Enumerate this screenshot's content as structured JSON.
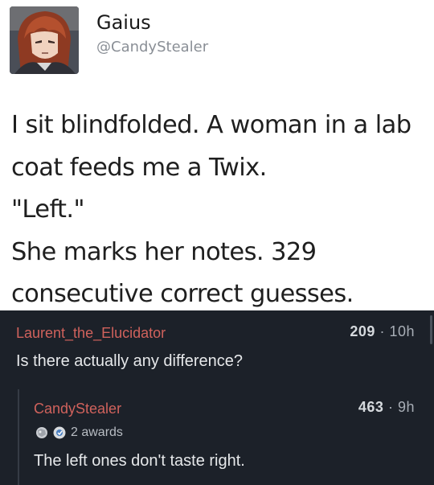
{
  "tweet": {
    "author_name": "Gaius",
    "author_handle": "@CandyStealer",
    "text_lines": [
      "I sit blindfolded. A woman in a lab",
      "coat feeds me a Twix.",
      "\"Left.\"",
      "She marks her notes. 329",
      "consecutive correct guesses."
    ]
  },
  "comments": [
    {
      "author": "Laurent_the_Elucidator",
      "score": "209",
      "separator": "·",
      "age": "10h",
      "text": "Is there actually any difference?"
    },
    {
      "author": "CandyStealer",
      "score": "463",
      "separator": "·",
      "age": "9h",
      "awards": "2 awards",
      "award_icons": [
        "silver-award-icon",
        "helpful-award-icon"
      ],
      "text": "The left ones don't taste right."
    }
  ],
  "colors": {
    "comment_author": "#d0625c",
    "comments_background": "#1c2129",
    "tweet_background": "#ffffff"
  }
}
